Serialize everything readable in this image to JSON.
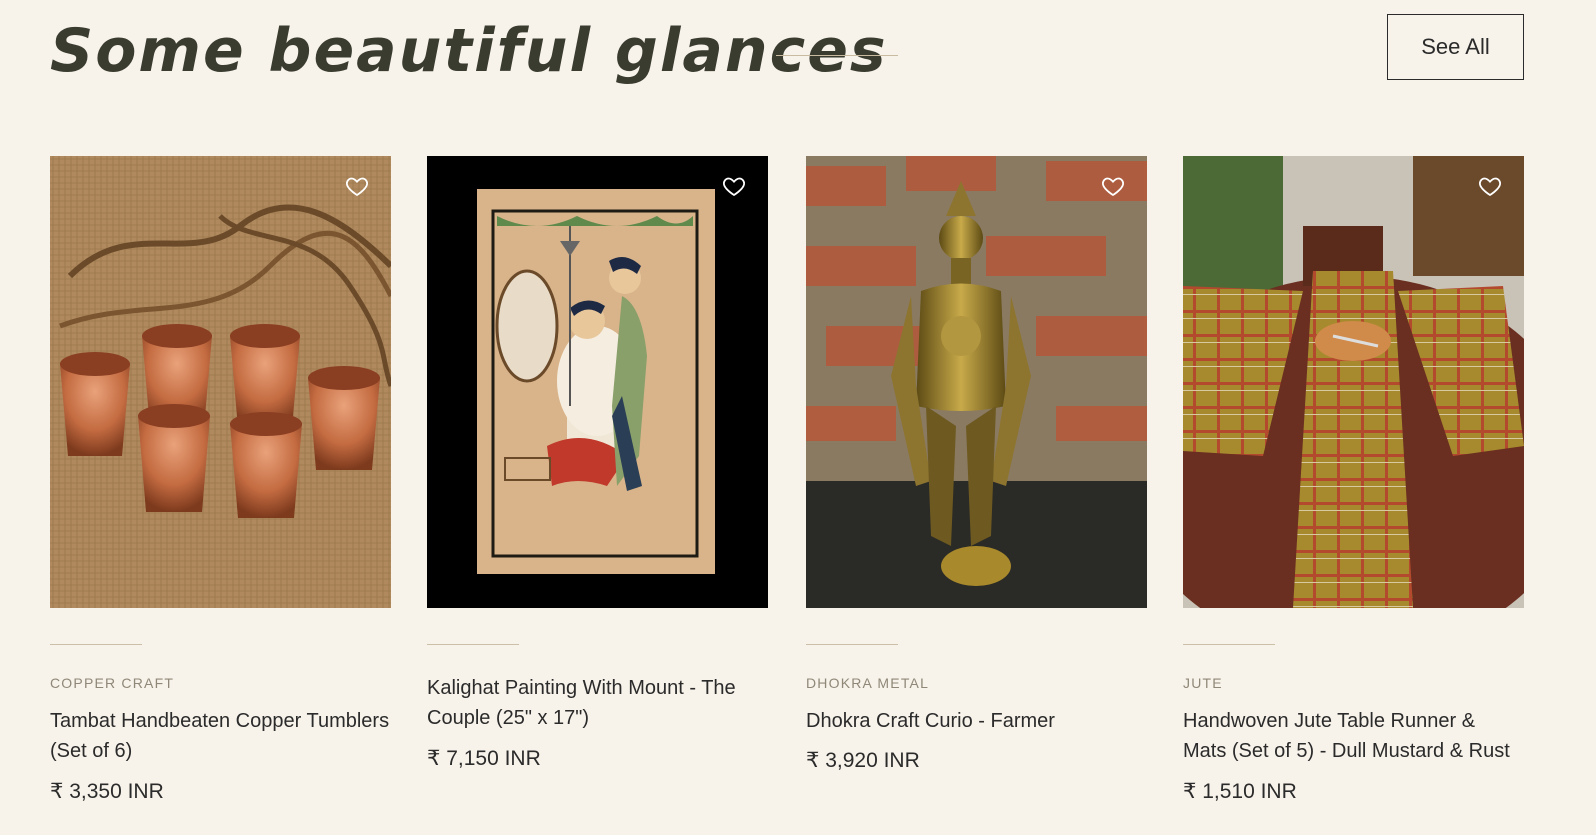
{
  "section": {
    "title": "Some beautiful glances",
    "see_all_label": "See All"
  },
  "products": [
    {
      "category": "COPPER CRAFT",
      "name": "Tambat Handbeaten Copper Tumblers (Set of 6)",
      "price": "₹ 3,350 INR",
      "image_icon": "copper-tumblers-image"
    },
    {
      "category": "",
      "name": "Kalighat Painting With Mount - The Couple (25\" x 17\")",
      "price": "₹ 7,150 INR",
      "image_icon": "kalighat-painting-image"
    },
    {
      "category": "DHOKRA METAL",
      "name": "Dhokra Craft Curio - Farmer",
      "price": "₹ 3,920 INR",
      "image_icon": "dhokra-farmer-image"
    },
    {
      "category": "JUTE",
      "name": "Handwoven Jute Table Runner & Mats (Set of 5) - Dull Mustard & Rust",
      "price": "₹ 1,510 INR",
      "image_icon": "jute-table-runner-image"
    }
  ]
}
